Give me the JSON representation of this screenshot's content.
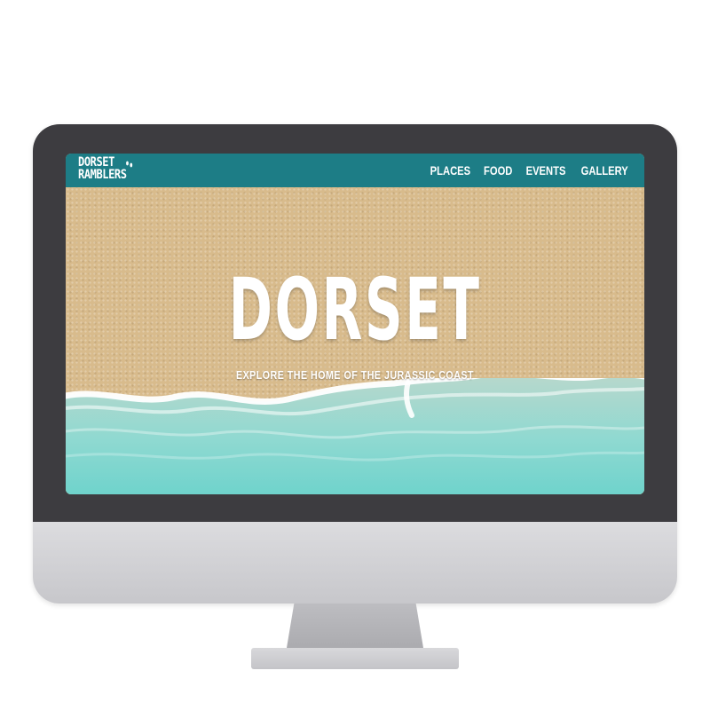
{
  "site": {
    "logo_line1": "DORSET",
    "logo_line2": "RAMBLERS",
    "nav": [
      "PLACES",
      "FOOD",
      "EVENTS",
      "GALLERY"
    ],
    "hero_title": "DORSET",
    "hero_subtitle": "EXPLORE THE HOME OF THE JURASSIC COAST"
  },
  "colors": {
    "navbar": "#1d7d86",
    "sand": "#d8bb8c",
    "sea": "#7fd6cf",
    "bezel": "#3d3c40",
    "chin": "#d1d1d4"
  },
  "icons": {
    "logo_mark": "footprints-icon"
  }
}
